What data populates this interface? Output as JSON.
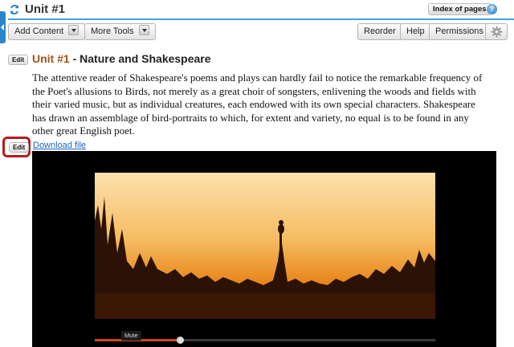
{
  "header": {
    "title": "Unit #1",
    "index_label": "Index of pages",
    "help_label": "?"
  },
  "toolbar": {
    "add_content_label": "Add Content",
    "more_tools_label": "More Tools",
    "reorder_label": "Reorder",
    "help_label": "Help",
    "permissions_label": "Permissions"
  },
  "section": {
    "edit_label": "Edit",
    "title_prefix": "Unit #1",
    "title_rest": " - Nature and Shakespeare",
    "body": "The attentive reader of Shakespeare's poems and plays can hardly fail to notice the remarkable frequency of the Poet's allusions to Birds, not merely as a great choir of songsters, enlivening the woods and fields with their varied music, but as individual creatures, each endowed with its own special characters. Shakespeare has drawn an assemblage of bird-portraits to which, for extent and variety, no equal is to be found in any other great English poet."
  },
  "media": {
    "edit_label": "Edit",
    "download_label": "Download file",
    "mute_tooltip": "Mute",
    "progress_fraction": 0.25,
    "colors": {
      "highlight": "#b81c1c",
      "link": "#1b62c4",
      "progress": "#c94a1a"
    }
  }
}
